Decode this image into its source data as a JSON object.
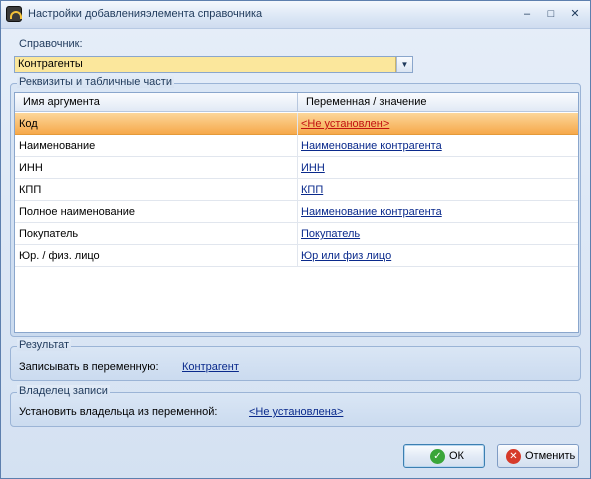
{
  "window": {
    "title": "Настройки добавленияэлемента справочника",
    "minimize_glyph": "–",
    "maximize_glyph": "□",
    "close_glyph": "✕"
  },
  "directory": {
    "label": "Справочник:",
    "value": "Контрагенты",
    "dropdown_glyph": "▼"
  },
  "attributes": {
    "title": "Реквизиты и табличные части",
    "columns": [
      "Имя аргумента",
      "Переменная / значение"
    ],
    "rows": [
      {
        "name": "Код",
        "value": "<Не установлен>",
        "selected": true
      },
      {
        "name": "Наименование",
        "value": "Наименование контрагента"
      },
      {
        "name": "ИНН",
        "value": "ИНН"
      },
      {
        "name": "КПП",
        "value": "КПП"
      },
      {
        "name": "Полное наименование",
        "value": "Наименование контрагента"
      },
      {
        "name": "Покупатель",
        "value": "Покупатель"
      },
      {
        "name": "Юр. / физ. лицо",
        "value": "Юр или физ лицо"
      }
    ]
  },
  "result": {
    "title": "Результат",
    "label": "Записывать в переменную:",
    "value": "Контрагент"
  },
  "owner": {
    "title": "Владелец записи",
    "label": "Установить владельца из переменной:",
    "value": "<Не установлена>"
  },
  "buttons": {
    "ok_label": "ОК",
    "ok_icon": "check-circle-icon",
    "cancel_label": "Отменить",
    "cancel_icon": "cancel-circle-icon"
  },
  "colors": {
    "selection": "#f6a94b",
    "link": "#0a2a8c",
    "unset_link": "#c21212",
    "ok_green": "#3aa63a",
    "cancel_red": "#d63a2a"
  }
}
